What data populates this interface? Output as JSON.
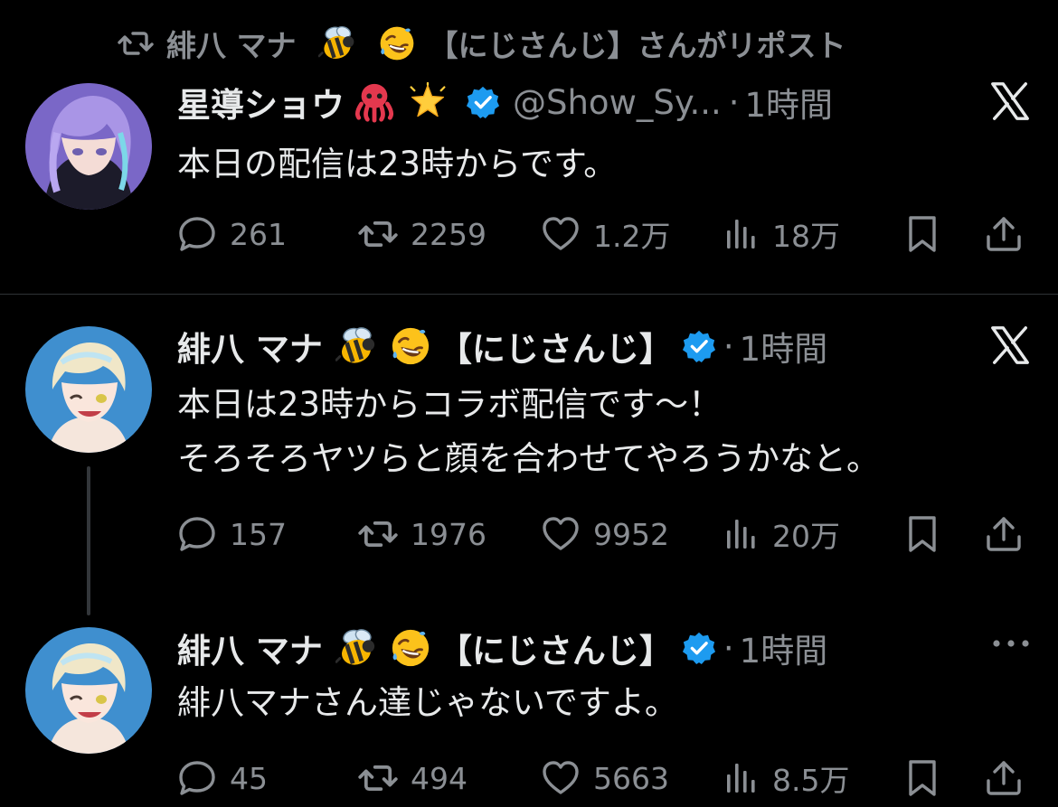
{
  "repost_banner": {
    "reposter_name": "緋八 マナ",
    "reposter_suffix": "【にじさんじ】さんがリポスト"
  },
  "posts": [
    {
      "author_name": "星導ショウ",
      "handle": "@Show_Sy...",
      "separator": "·",
      "time": "1時間",
      "text_lines": [
        "本日の配信は23時からです。"
      ],
      "stats": {
        "replies": "261",
        "reposts": "2259",
        "likes": "1.2万",
        "views": "18万"
      },
      "corner_icon": "x-logo-icon",
      "emojis": [
        "octopus-emoji",
        "glowing-star-emoji"
      ]
    },
    {
      "author_name": "緋八 マナ",
      "affiliation": "【にじさんじ】",
      "separator": "·",
      "time": "1時間",
      "text_lines": [
        "本日は23時からコラボ配信です～！",
        "そろそろヤツらと顔を合わせてやろうかなと。"
      ],
      "stats": {
        "replies": "157",
        "reposts": "1976",
        "likes": "9952",
        "views": "20万"
      },
      "corner_icon": "x-logo-icon",
      "emojis": [
        "bee-emoji",
        "rofl-emoji"
      ]
    },
    {
      "author_name": "緋八 マナ",
      "affiliation": "【にじさんじ】",
      "separator": "·",
      "time": "1時間",
      "text_lines": [
        "緋八マナさん達じゃないですよ。"
      ],
      "stats": {
        "replies": "45",
        "reposts": "494",
        "likes": "5663",
        "views": "8.5万"
      },
      "corner_icon": "more-options-icon",
      "emojis": [
        "bee-emoji",
        "rofl-emoji"
      ]
    }
  ],
  "colors": {
    "background": "#000000",
    "text": "#e7e9ea",
    "secondary_text": "#8b8f94",
    "verified_blue": "#1d9bf0",
    "divider": "#2f3336"
  }
}
